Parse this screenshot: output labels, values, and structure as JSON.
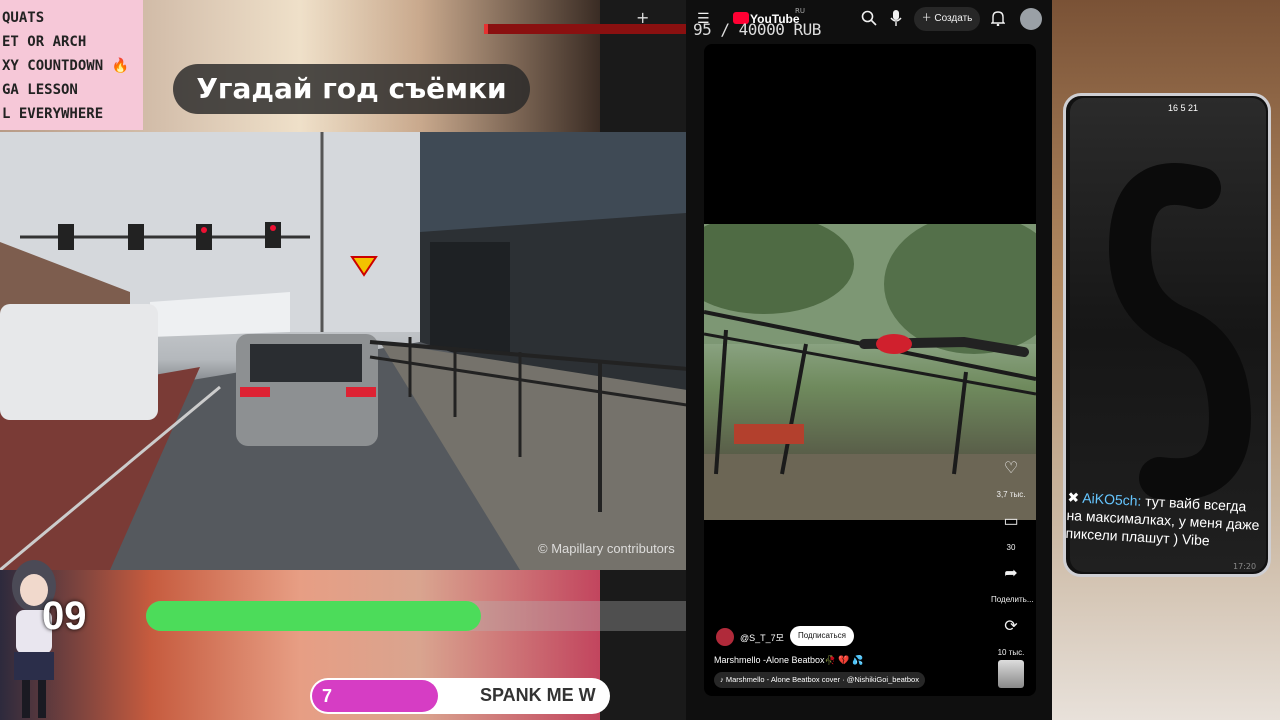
{
  "stream": {
    "promo_lines": [
      "QUATS",
      "ET OR ARCH",
      "XY COUNTDOWN",
      "GA LESSON",
      "L EVERYWHERE"
    ],
    "guess_title": "Угадай год съёмки",
    "donation_goal": "95 / 40000 RUB",
    "plus_label": "+",
    "mapillary_credit": "© Mapillary contributors",
    "counter_value": "09",
    "green_progress": 0.6,
    "pink_progress": 0.42,
    "pink_number": "7",
    "pink_text": "SPANK ME W"
  },
  "youtube": {
    "logo": "YouTube",
    "region": "RU",
    "create_label": "Создать",
    "likes": "3,7 тыс.",
    "comments": "30",
    "share": "Поделить...",
    "remix": "10 тыс.",
    "channel": "@S_T_7모",
    "subscribe_label": "Подписаться",
    "title": "Marshmello -Alone Beatbox🥀 💔 💦",
    "sound": "Marshmello - Alone Beatbox cover · @NishikiGoi_beatbox"
  },
  "phone": {
    "status": "16  5  21",
    "chat_user": "AiKO5ch:",
    "chat_text": "тут вайб всегда на максималках, у меня даже пиксели плашут ) Vibe",
    "time": "17:20"
  },
  "icons": {
    "menu": "menu-icon",
    "search": "search-icon",
    "mic": "mic-icon",
    "bell": "bell-icon",
    "heart": "heart-icon",
    "comment": "comment-icon",
    "share": "share-icon",
    "remix": "remix-icon"
  },
  "colors": {
    "youtube_red": "#ff0033",
    "green_bar": "#4cdc5a",
    "pink_bar": "#d63dc4",
    "donate_bar": "#8a1010"
  }
}
